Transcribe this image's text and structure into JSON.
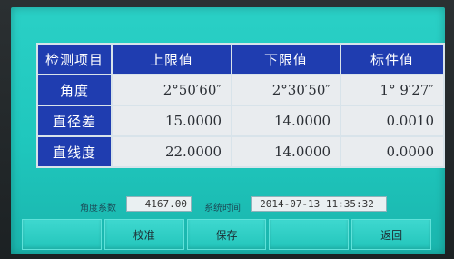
{
  "table": {
    "headers": [
      "检测项目",
      "上限值",
      "下限值",
      "标件值"
    ],
    "rows": [
      {
        "name": "角度",
        "upper": "2°50′60″",
        "lower": "2°30′50″",
        "standard": "1° 9′27″"
      },
      {
        "name": "直径差",
        "upper": "15.0000",
        "lower": "14.0000",
        "standard": "0.0010"
      },
      {
        "name": "直线度",
        "upper": "22.0000",
        "lower": "14.0000",
        "standard": "0.0000"
      }
    ]
  },
  "info": {
    "angle_coef_label": "角度系数",
    "angle_coef_value": "4167.00",
    "time_label": "系统时间",
    "time_value": "2014-07-13 11:35:32"
  },
  "buttons": [
    "",
    "校准",
    "保存",
    "",
    "返回"
  ]
}
